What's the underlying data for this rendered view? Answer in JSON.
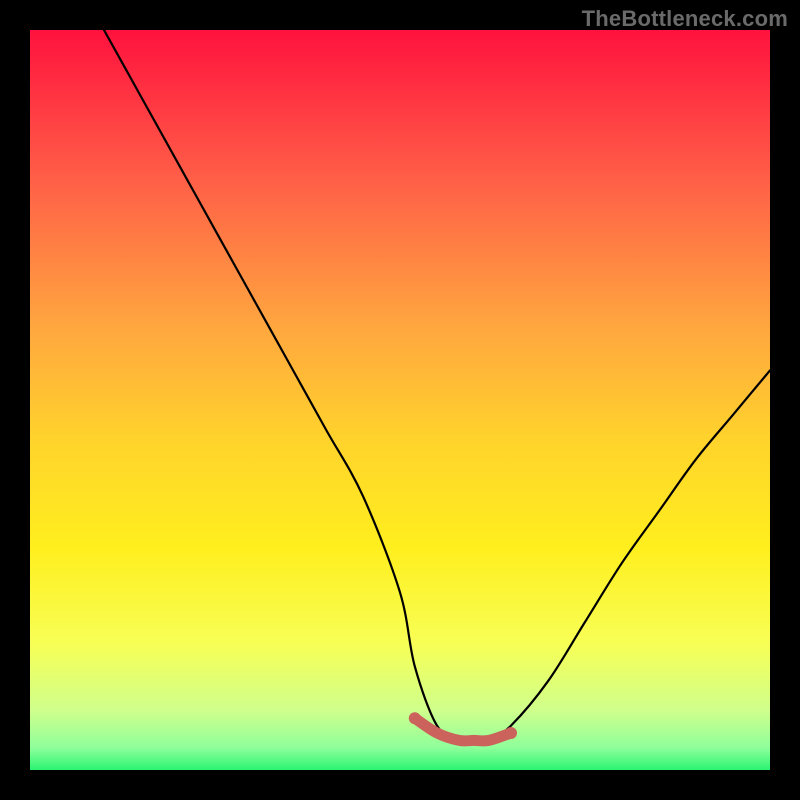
{
  "watermark": "TheBottleneck.com",
  "chart_data": {
    "type": "line",
    "title": "",
    "xlabel": "",
    "ylabel": "",
    "xlim": [
      0,
      100
    ],
    "ylim": [
      0,
      100
    ],
    "grid": false,
    "series": [
      {
        "name": "main-curve",
        "color": "#000000",
        "x": [
          10,
          15,
          20,
          25,
          30,
          35,
          40,
          45,
          50,
          52,
          55,
          58,
          60,
          62,
          65,
          70,
          75,
          80,
          85,
          90,
          95,
          100
        ],
        "y": [
          100,
          91,
          82,
          73,
          64,
          55,
          46,
          37,
          24,
          14,
          6,
          4,
          4,
          4,
          6,
          12,
          20,
          28,
          35,
          42,
          48,
          54
        ]
      },
      {
        "name": "highlight-band",
        "color": "#cb625b",
        "x": [
          52,
          55,
          58,
          60,
          62,
          65
        ],
        "y": [
          7,
          5,
          4,
          4,
          4,
          5
        ]
      }
    ],
    "background_gradient": {
      "type": "vertical",
      "stops": [
        {
          "offset": 0.0,
          "color": "#ff123e"
        },
        {
          "offset": 0.2,
          "color": "#ff5e47"
        },
        {
          "offset": 0.4,
          "color": "#ffa63f"
        },
        {
          "offset": 0.55,
          "color": "#ffd22c"
        },
        {
          "offset": 0.7,
          "color": "#ffef1e"
        },
        {
          "offset": 0.83,
          "color": "#f7ff56"
        },
        {
          "offset": 0.92,
          "color": "#cfff8c"
        },
        {
          "offset": 0.97,
          "color": "#8eff9b"
        },
        {
          "offset": 1.0,
          "color": "#2af471"
        }
      ]
    }
  }
}
